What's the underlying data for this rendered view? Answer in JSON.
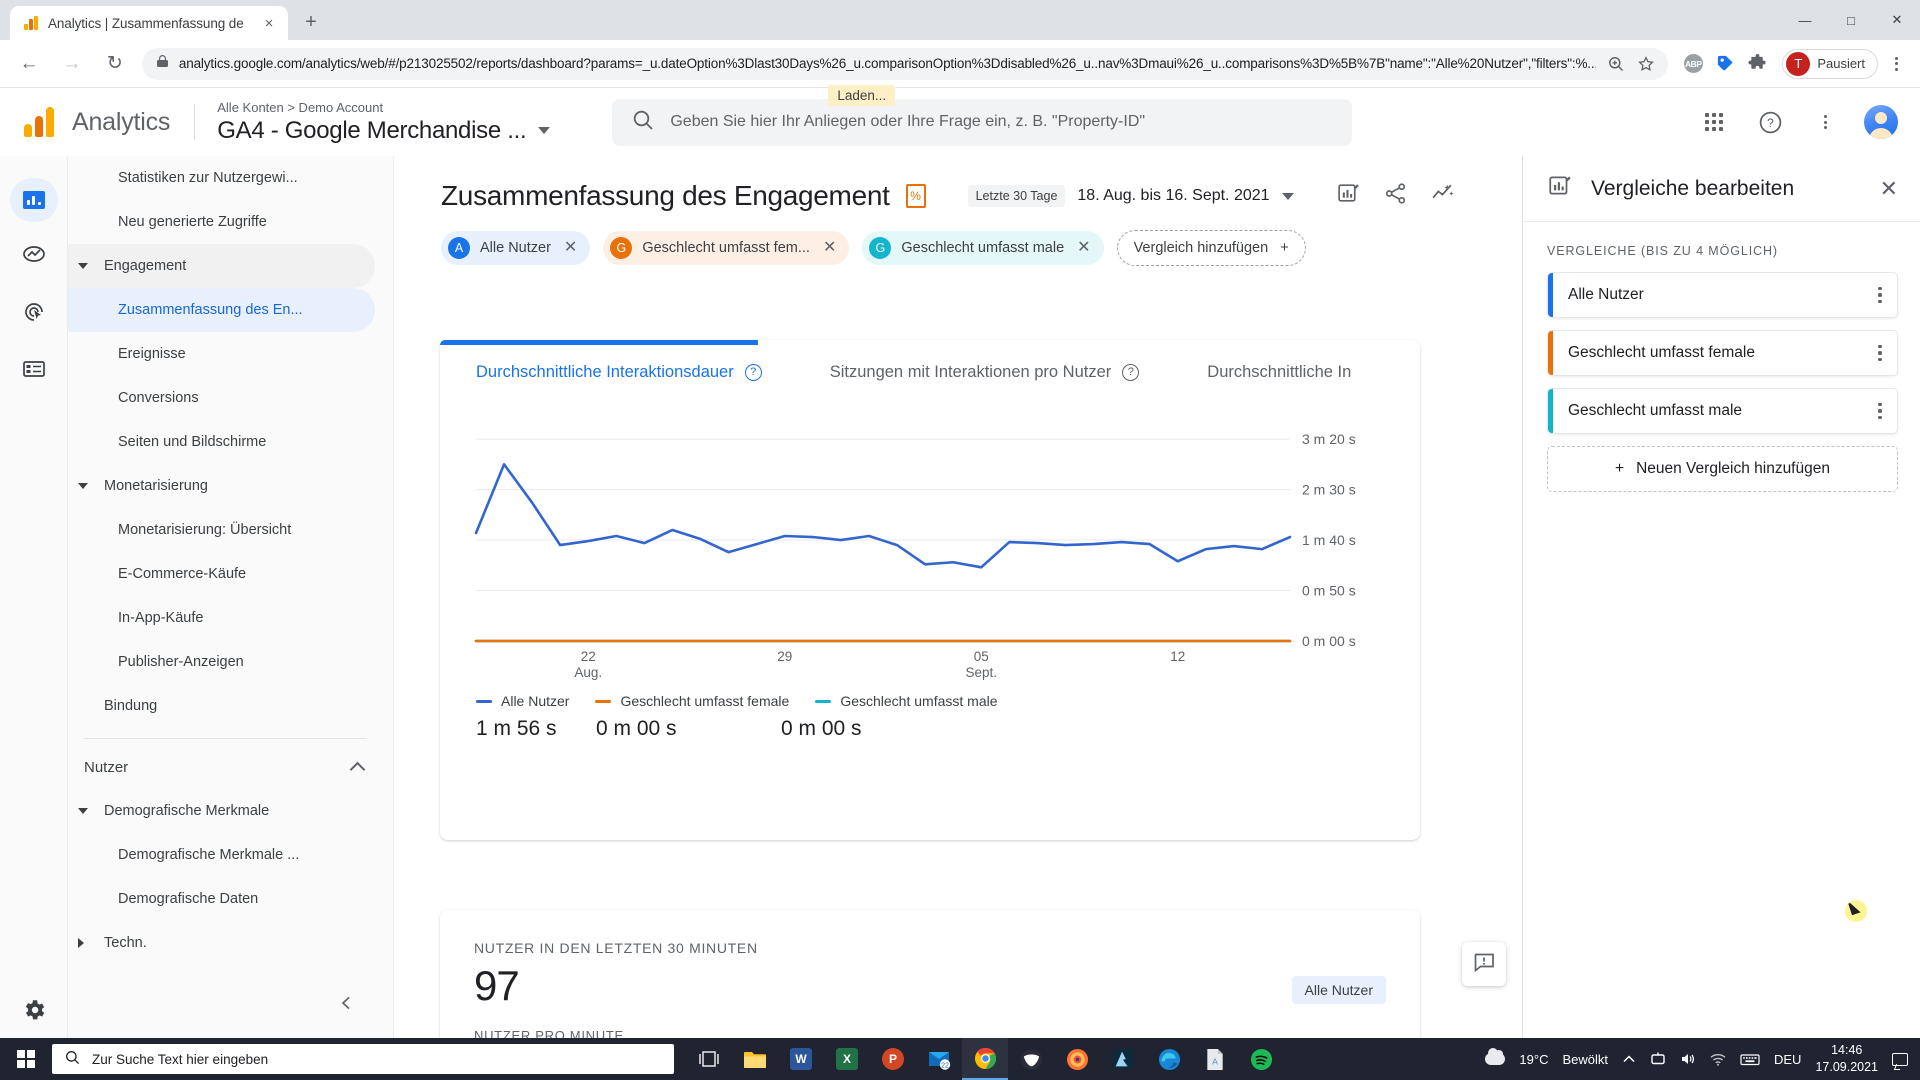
{
  "browser": {
    "tab": {
      "title": "Analytics | Zusammenfassung de",
      "favicon": "ga-bars-icon",
      "close": "×"
    },
    "new_tab_label": "+",
    "window_controls": {
      "minimize": "—",
      "maximize": "□",
      "close": "✕"
    },
    "nav": {
      "back": "←",
      "forward": "→",
      "reload": "↻"
    },
    "url_main": "analytics.google.com/analytics/web/#/p213025502/reports/dashboard?params=_u.dateOption%3Dlast30Days%26_u.comparisonOption%3Ddisabled%26_u..nav%3Dmaui%26_u..comparisons%3D%5B%7B\"name\":\"Alle%20Nutzer\",\"filters\":%...",
    "lock_icon": "lock-icon",
    "zoom_icon": "zoom-search-icon",
    "bookmark_icon": "star-icon",
    "extensions": [
      {
        "name": "adblock-plus-icon",
        "label": "ABP"
      },
      {
        "name": "tag-assistant-icon",
        "label": ""
      },
      {
        "name": "extensions-puzzle-icon",
        "label": ""
      }
    ],
    "profile": {
      "initial": "T",
      "label": "Pausiert"
    },
    "menu_icon": "chrome-menu-icon"
  },
  "ga_header": {
    "product_name": "Analytics",
    "breadcrumb": "Alle Konten > Demo Account",
    "property": "GA4 - Google Merchandise ...",
    "property_caret": "chevron-down-icon",
    "search_placeholder": "Geben Sie hier Ihr Anliegen oder Ihre Frage ein, z. B. \"Property-ID\"",
    "loading_tooltip": "Laden...",
    "apps_icon": "apps-grid-icon",
    "help_icon": "help-icon",
    "more_icon": "more-vertical-icon",
    "avatar_icon": "user-avatar"
  },
  "rail": {
    "items": [
      {
        "name": "rail-home",
        "icon": "bar-chart-icon",
        "active": true
      },
      {
        "name": "rail-reports",
        "icon": "insights-icon",
        "active": false
      },
      {
        "name": "rail-explore",
        "icon": "explore-target-icon",
        "active": false
      },
      {
        "name": "rail-advertising",
        "icon": "list-table-icon",
        "active": false
      }
    ],
    "settings_icon": "gear-icon"
  },
  "sidebar": {
    "items": [
      {
        "label": "Statistiken zur Nutzergewi...",
        "level": 2,
        "state": "normal"
      },
      {
        "label": "Neu generierte Zugriffe",
        "level": 2,
        "state": "normal"
      },
      {
        "label": "Engagement",
        "level": 1,
        "state": "group",
        "arrow": "down"
      },
      {
        "label": "Zusammenfassung des En...",
        "level": 2,
        "state": "selected"
      },
      {
        "label": "Ereignisse",
        "level": 2,
        "state": "normal"
      },
      {
        "label": "Conversions",
        "level": 2,
        "state": "normal"
      },
      {
        "label": "Seiten und Bildschirme",
        "level": 2,
        "state": "normal"
      },
      {
        "label": "Monetarisierung",
        "level": 1,
        "state": "normal",
        "arrow": "down"
      },
      {
        "label": "Monetarisierung: Übersicht",
        "level": 2,
        "state": "normal"
      },
      {
        "label": "E-Commerce-Käufe",
        "level": 2,
        "state": "normal"
      },
      {
        "label": "In-App-Käufe",
        "level": 2,
        "state": "normal"
      },
      {
        "label": "Publisher-Anzeigen",
        "level": 2,
        "state": "normal"
      },
      {
        "label": "Bindung",
        "level": 1,
        "state": "normal",
        "arrow": "none"
      }
    ],
    "section": {
      "label": "Nutzer",
      "chevron": "chevron-up-icon"
    },
    "items2": [
      {
        "label": "Demografische Merkmale",
        "level": 1,
        "state": "normal",
        "arrow": "down"
      },
      {
        "label": "Demografische Merkmale ...",
        "level": 2,
        "state": "normal"
      },
      {
        "label": "Demografische Daten",
        "level": 2,
        "state": "normal"
      },
      {
        "label": "Techn.",
        "level": 1,
        "state": "normal",
        "arrow": "right"
      }
    ],
    "collapse_icon": "chevron-left-icon"
  },
  "report": {
    "title": "Zusammenfassung des Engagement",
    "title_badge": "percent-badge-icon",
    "date_pill": "Letzte 30 Tage",
    "date_range": "18. Aug. bis 16. Sept. 2021",
    "date_caret": "chevron-down-icon",
    "actions": [
      {
        "name": "edit-comparisons-icon",
        "glyph": "✎"
      },
      {
        "name": "share-icon",
        "glyph": "<"
      },
      {
        "name": "insights-sparkle-icon",
        "glyph": "✧"
      }
    ],
    "chips": [
      {
        "badge": "A",
        "label": "Alle Nutzer",
        "color": "#1a73e8",
        "bg": "#e8f0fe",
        "close": "✕"
      },
      {
        "badge": "G",
        "label": "Geschlecht umfasst fem...",
        "color": "#e8710a",
        "bg": "#fdefe3",
        "close": "✕"
      },
      {
        "badge": "G",
        "label": "Geschlecht umfasst male",
        "color": "#12b5cb",
        "bg": "#e4f7f9",
        "close": "✕"
      }
    ],
    "add_comparison": {
      "label": "Vergleich hinzufügen",
      "plus": "+"
    }
  },
  "chart_card": {
    "tabs": [
      {
        "label": "Durchschnittliche Interaktionsdauer",
        "help": "?",
        "active": true
      },
      {
        "label": "Sitzungen mit Interaktionen pro Nutzer",
        "help": "?",
        "active": false
      },
      {
        "label": "Durchschnittliche In",
        "help": "",
        "active": false
      }
    ],
    "legend": [
      {
        "label": "Alle Nutzer",
        "color": "#3366cc",
        "value": "1 m 56 s"
      },
      {
        "label": "Geschlecht umfasst female",
        "color": "#e8710a",
        "value": "0 m 00 s"
      },
      {
        "label": "Geschlecht umfasst male",
        "color": "#12b5cb",
        "value": "0 m 00 s"
      }
    ]
  },
  "chart_data": {
    "type": "line",
    "title": "Durchschnittliche Interaktionsdauer",
    "xlabel": "",
    "ylabel": "Durchschnittliche Interaktionsdauer",
    "grid": true,
    "legend_position": "bottom",
    "ytick_labels": [
      "3 m 20 s",
      "2 m 30 s",
      "1 m 40 s",
      "0 m 50 s",
      "0 m 00 s"
    ],
    "ytick_values": [
      200,
      150,
      100,
      50,
      0
    ],
    "ylim": [
      0,
      210
    ],
    "xtick_labels": [
      "22\nAug.",
      "29",
      "05\nSept.",
      "12"
    ],
    "xtick_indices": [
      4,
      11,
      18,
      25
    ],
    "x": [
      "18. Aug.",
      "19. Aug.",
      "20. Aug.",
      "21. Aug.",
      "22. Aug.",
      "23. Aug.",
      "24. Aug.",
      "25. Aug.",
      "26. Aug.",
      "27. Aug.",
      "28. Aug.",
      "29. Aug.",
      "30. Aug.",
      "31. Aug.",
      "01. Sept.",
      "02. Sept.",
      "03. Sept.",
      "04. Sept.",
      "05. Sept.",
      "06. Sept.",
      "07. Sept.",
      "08. Sept.",
      "09. Sept.",
      "10. Sept.",
      "11. Sept.",
      "12. Sept.",
      "13. Sept.",
      "14. Sept.",
      "15. Sept.",
      "16. Sept."
    ],
    "series": [
      {
        "name": "Alle Nutzer",
        "color": "#3366cc",
        "units": "seconds",
        "values": [
          107,
          175,
          137,
          95,
          99,
          104,
          97,
          110,
          101,
          88,
          96,
          104,
          103,
          100,
          104,
          95,
          76,
          78,
          73,
          98,
          97,
          95,
          96,
          98,
          96,
          79,
          91,
          94,
          91,
          103
        ]
      },
      {
        "name": "Geschlecht umfasst female",
        "color": "#e8710a",
        "units": "seconds",
        "values": [
          0,
          0,
          0,
          0,
          0,
          0,
          0,
          0,
          0,
          0,
          0,
          0,
          0,
          0,
          0,
          0,
          0,
          0,
          0,
          0,
          0,
          0,
          0,
          0,
          0,
          0,
          0,
          0,
          0,
          0
        ]
      },
      {
        "name": "Geschlecht umfasst male",
        "color": "#12b5cb",
        "units": "seconds",
        "values": [
          0,
          0,
          0,
          0,
          0,
          0,
          0,
          0,
          0,
          0,
          0,
          0,
          0,
          0,
          0,
          0,
          0,
          0,
          0,
          0,
          0,
          0,
          0,
          0,
          0,
          0,
          0,
          0,
          0,
          0
        ]
      }
    ],
    "summary_values": {
      "Alle Nutzer": "1 m 56 s",
      "Geschlecht umfasst female": "0 m 00 s",
      "Geschlecht umfasst male": "0 m 00 s"
    }
  },
  "realtime_card": {
    "label": "NUTZER IN DEN LETZTEN 30 MINUTEN",
    "value": "97",
    "chip": "Alle Nutzer",
    "sublabel": "NUTZER PRO MINUTE"
  },
  "feedback_button": {
    "icon": "feedback-icon"
  },
  "comparison_panel": {
    "icon": "edit-comparisons-icon",
    "title": "Vergleiche bearbeiten",
    "close": "✕",
    "section_label": "VERGLEICHE (BIS ZU 4 MÖGLICH)",
    "items": [
      {
        "label": "Alle Nutzer",
        "color": "#1a73e8",
        "menu": "more-vertical-icon"
      },
      {
        "label": "Geschlecht umfasst female",
        "color": "#e8710a",
        "menu": "more-vertical-icon"
      },
      {
        "label": "Geschlecht umfasst male",
        "color": "#12b5cb",
        "menu": "more-vertical-icon"
      }
    ],
    "add_label": "Neuen Vergleich hinzufügen",
    "add_plus": "+"
  },
  "taskbar": {
    "start_icon": "windows-start-icon",
    "search_placeholder": "Zur Suche Text hier eingeben",
    "search_icon": "search-icon",
    "task_view_icon": "task-view-icon",
    "apps": [
      {
        "name": "file-explorer-icon",
        "label": "",
        "color": "#ffb900",
        "active": false
      },
      {
        "name": "word-icon",
        "label": "W",
        "color": "#2b579a",
        "active": false
      },
      {
        "name": "excel-icon",
        "label": "X",
        "color": "#217346",
        "active": false
      },
      {
        "name": "powerpoint-icon",
        "label": "P",
        "color": "#d24726",
        "active": false
      },
      {
        "name": "outlook-icon",
        "label": "22",
        "color": "#0072c6",
        "active": false
      },
      {
        "name": "chrome-icon",
        "label": "",
        "color": "#4285f4",
        "active": true
      },
      {
        "name": "thunderbird-icon",
        "label": "",
        "color": "#3a3a3a",
        "active": false
      },
      {
        "name": "firefox-icon",
        "label": "",
        "color": "#ff7139",
        "active": false
      },
      {
        "name": "photoshop-icon",
        "label": "",
        "color": "#001e36",
        "active": false
      },
      {
        "name": "edge-icon",
        "label": "",
        "color": "#0f8bd8",
        "active": false
      },
      {
        "name": "acrobat-icon",
        "label": "A",
        "color": "#dedede",
        "active": false
      },
      {
        "name": "spotify-icon",
        "label": "",
        "color": "#1db954",
        "active": false
      }
    ],
    "weather": {
      "temperature": "19°C",
      "condition": "Bewölkt",
      "icon": "cloud-icon"
    },
    "tray": {
      "expand_icon": "chevron-up-icon",
      "screencast_icon": "screencast-icon",
      "volume_icon": "speaker-icon",
      "network_icon": "wifi-icon",
      "keyboard_icon": "keyboard-icon",
      "language": "DEU",
      "time": "14:46",
      "date": "17.09.2021",
      "notification_icon": "notification-icon"
    }
  }
}
